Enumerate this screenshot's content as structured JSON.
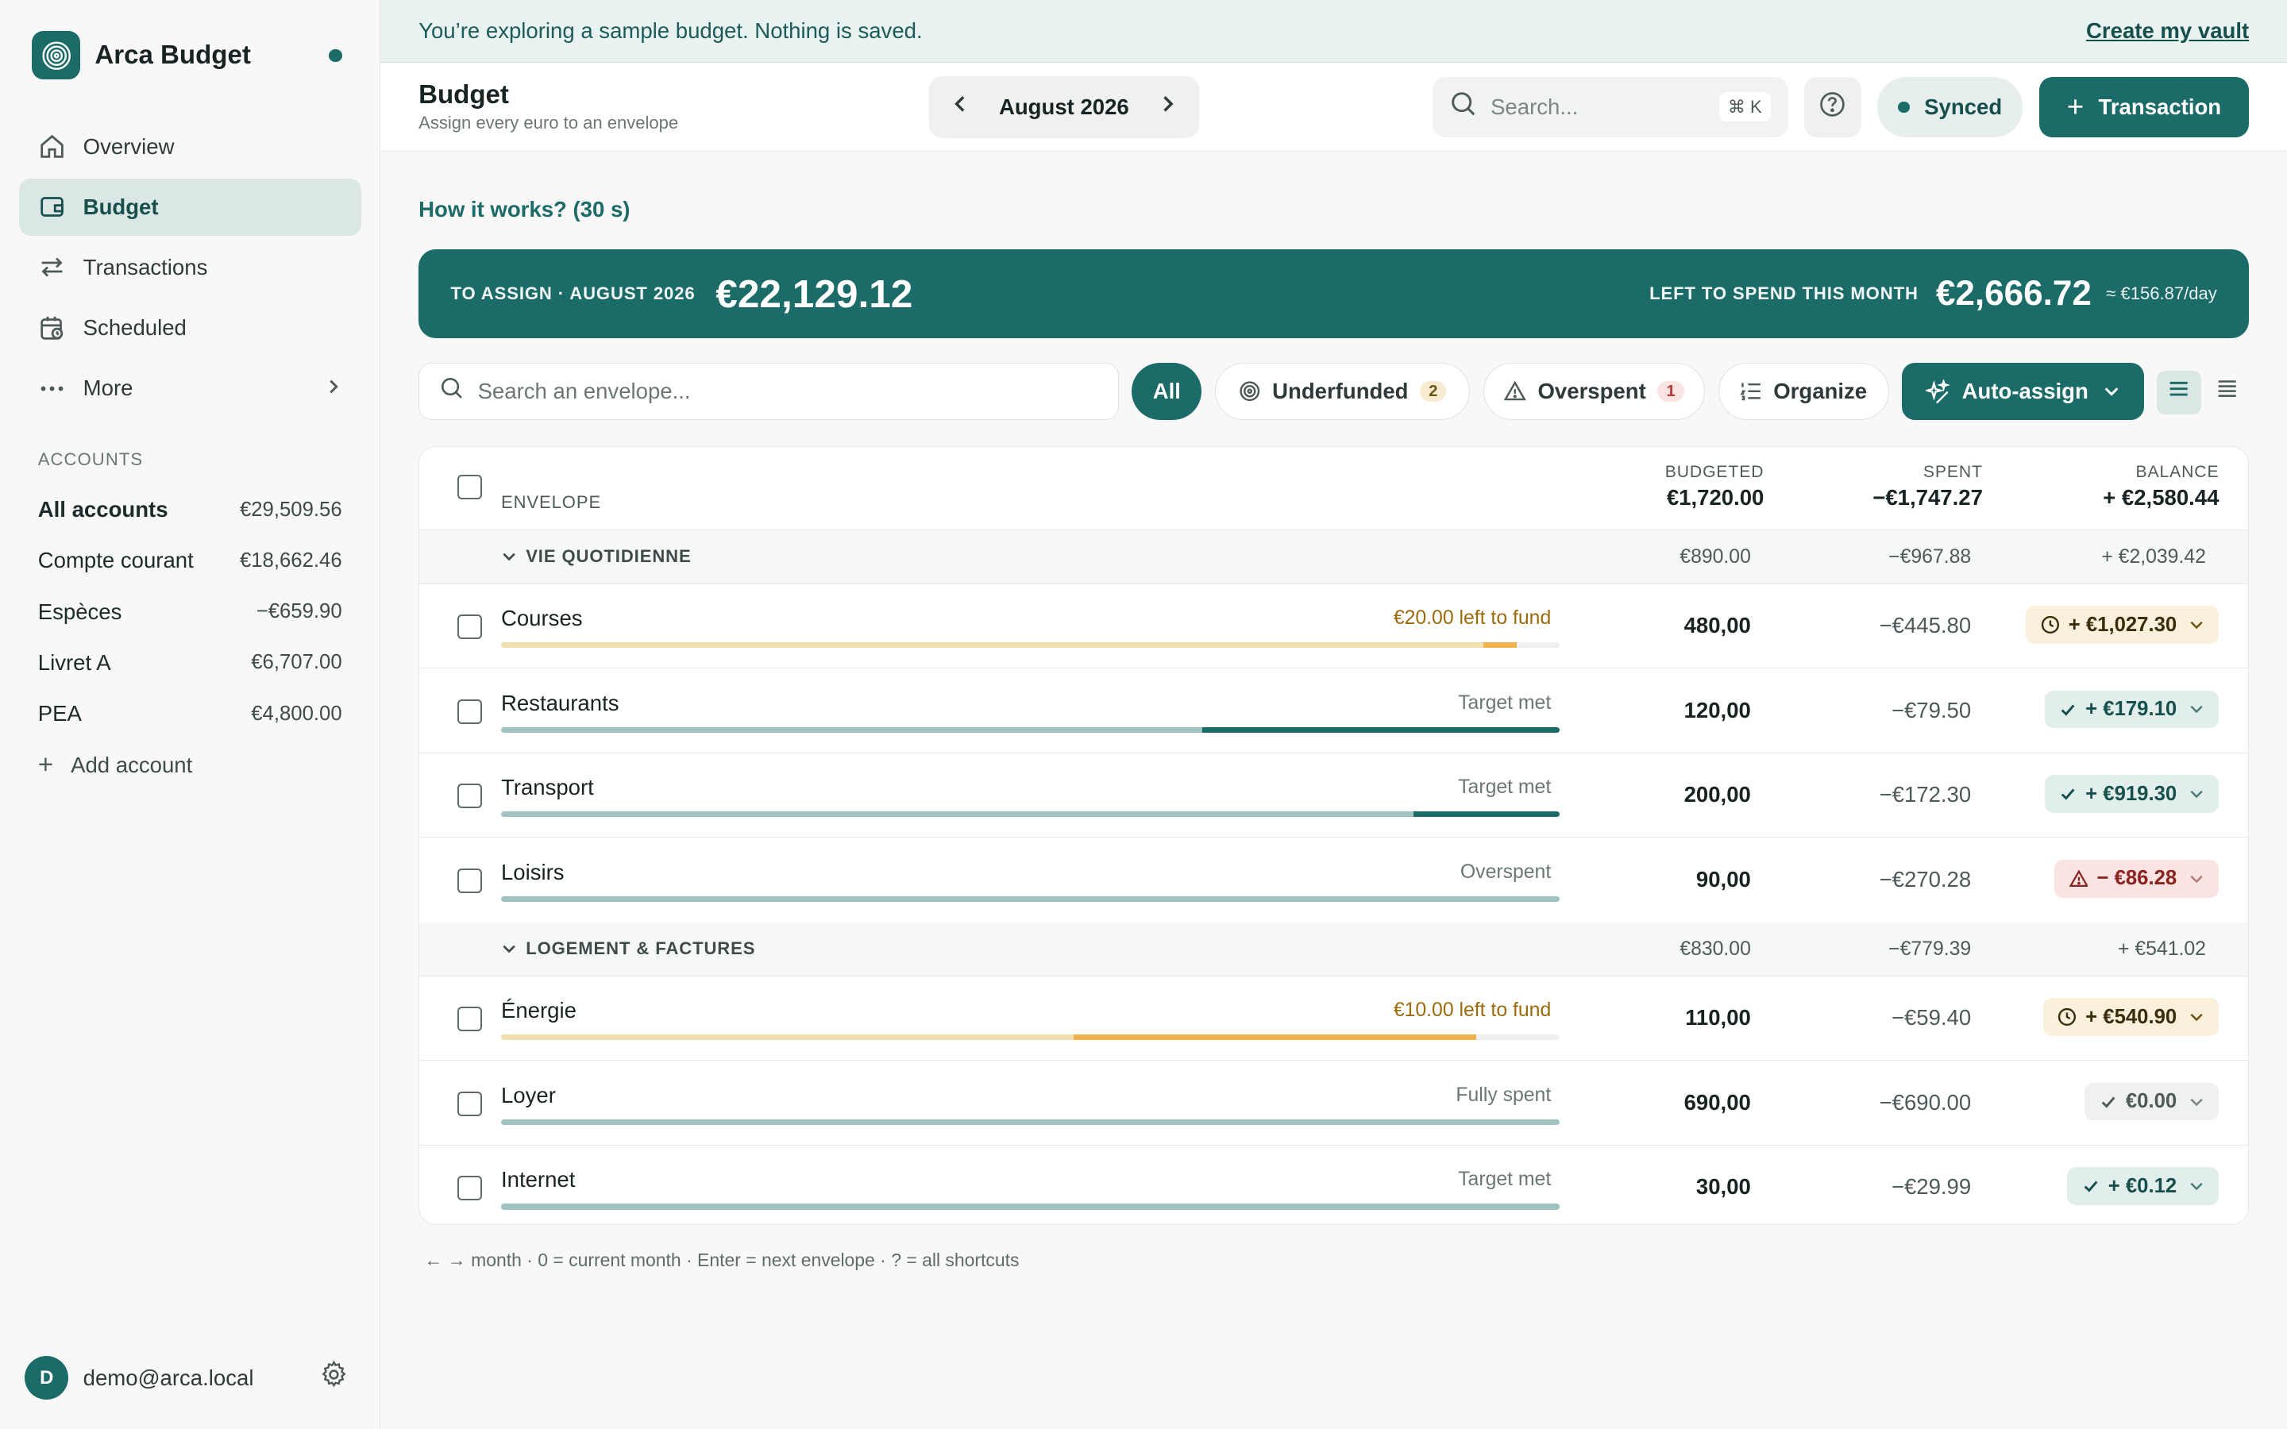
{
  "app": {
    "name": "Arca Budget"
  },
  "sidebar": {
    "nav": [
      {
        "label": "Overview",
        "icon": "home-icon"
      },
      {
        "label": "Budget",
        "icon": "wallet-icon",
        "active": true
      },
      {
        "label": "Transactions",
        "icon": "transfer-icon"
      },
      {
        "label": "Scheduled",
        "icon": "calendar-clock-icon"
      },
      {
        "label": "More",
        "icon": "more-dots-icon"
      }
    ],
    "accounts_title": "ACCOUNTS",
    "accounts": [
      {
        "name": "All accounts",
        "value": "€29,509.56"
      },
      {
        "name": "Compte courant",
        "value": "€18,662.46"
      },
      {
        "name": "Espèces",
        "value": "−€659.90"
      },
      {
        "name": "Livret A",
        "value": "€6,707.00"
      },
      {
        "name": "PEA",
        "value": "€4,800.00"
      }
    ],
    "add_account": "Add account",
    "user": {
      "initial": "D",
      "email": "demo@arca.local"
    }
  },
  "banner": {
    "text": "You’re exploring a sample budget. Nothing is saved.",
    "link": "Create my vault"
  },
  "header": {
    "title": "Budget",
    "subtitle": "Assign every euro to an envelope",
    "month": "August 2026",
    "search_placeholder": "Search...",
    "search_shortcut": "⌘ K",
    "sync_status": "Synced",
    "transaction_button": "Transaction"
  },
  "how_it_works": "How it works? (30 s)",
  "assign": {
    "label": "TO ASSIGN · AUGUST 2026",
    "amount": "€22,129.12",
    "left_label": "LEFT TO SPEND THIS MONTH",
    "left_amount": "€2,666.72",
    "per_day": "≈ €156.87/day"
  },
  "filters": {
    "search_placeholder": "Search an envelope...",
    "all": "All",
    "underfunded": "Underfunded",
    "underfunded_count": "2",
    "overspent": "Overspent",
    "overspent_count": "1",
    "organize": "Organize",
    "auto_assign": "Auto-assign"
  },
  "table": {
    "col_envelope": "ENVELOPE",
    "col_budgeted": "BUDGETED",
    "col_spent": "SPENT",
    "col_balance": "BALANCE",
    "total_budgeted": "€1,720.00",
    "total_spent": "−€1,747.27",
    "total_balance": "+ €2,580.44",
    "groups": [
      {
        "name": "VIE QUOTIDIENNE",
        "budgeted": "€890.00",
        "spent": "−€967.88",
        "balance": "+ €2,039.42",
        "rows": [
          {
            "name": "Courses",
            "status": "€20.00 left to fund",
            "status_kind": "warn",
            "budgeted": "480,00",
            "spent": "−€445.80",
            "balance": "+ €1,027.30",
            "chip": "pending",
            "progress_base": 0.928,
            "progress_fill": 0.031,
            "fill_color": "#f0b24a",
            "base_color": "#f2dfb0"
          },
          {
            "name": "Restaurants",
            "status": "Target met",
            "status_kind": "",
            "budgeted": "120,00",
            "spent": "−€79.50",
            "balance": "+ €179.10",
            "chip": "ok",
            "progress_base": 0.662,
            "progress_fill": 0.338,
            "fill_color": "#1b6b68",
            "base_color": "#9fc4c0"
          },
          {
            "name": "Transport",
            "status": "Target met",
            "status_kind": "",
            "budgeted": "200,00",
            "spent": "−€172.30",
            "balance": "+ €919.30",
            "chip": "ok",
            "progress_base": 0.862,
            "progress_fill": 0.138,
            "fill_color": "#1b6b68",
            "base_color": "#9fc4c0"
          },
          {
            "name": "Loisirs",
            "status": "Overspent",
            "status_kind": "",
            "budgeted": "90,00",
            "spent": "−€270.28",
            "balance": "− €86.28",
            "chip": "bad",
            "progress_base": 1.0,
            "progress_fill": 0,
            "fill_color": "#1b6b68",
            "base_color": "#9fc4c0"
          }
        ]
      },
      {
        "name": "LOGEMENT & FACTURES",
        "budgeted": "€830.00",
        "spent": "−€779.39",
        "balance": "+ €541.02",
        "rows": [
          {
            "name": "Énergie",
            "status": "€10.00 left to fund",
            "status_kind": "warn",
            "budgeted": "110,00",
            "spent": "−€59.40",
            "balance": "+ €540.90",
            "chip": "pending",
            "progress_base": 0.541,
            "progress_fill": 0.38,
            "fill_color": "#f0b24a",
            "base_color": "#f2dfb0"
          },
          {
            "name": "Loyer",
            "status": "Fully spent",
            "status_kind": "",
            "budgeted": "690,00",
            "spent": "−€690.00",
            "balance": "€0.00",
            "chip": "zero",
            "progress_base": 1.0,
            "progress_fill": 0,
            "fill_color": "#1b6b68",
            "base_color": "#9fc4c0"
          },
          {
            "name": "Internet",
            "status": "Target met",
            "status_kind": "",
            "budgeted": "30,00",
            "spent": "−€29.99",
            "balance": "+ €0.12",
            "chip": "ok",
            "progress_base": 1.0,
            "progress_fill": 0,
            "fill_color": "#1b6b68",
            "base_color": "#9fc4c0"
          }
        ]
      }
    ]
  },
  "shortcuts": "← → month · 0 = current month · Enter = next envelope · ? = all shortcuts"
}
